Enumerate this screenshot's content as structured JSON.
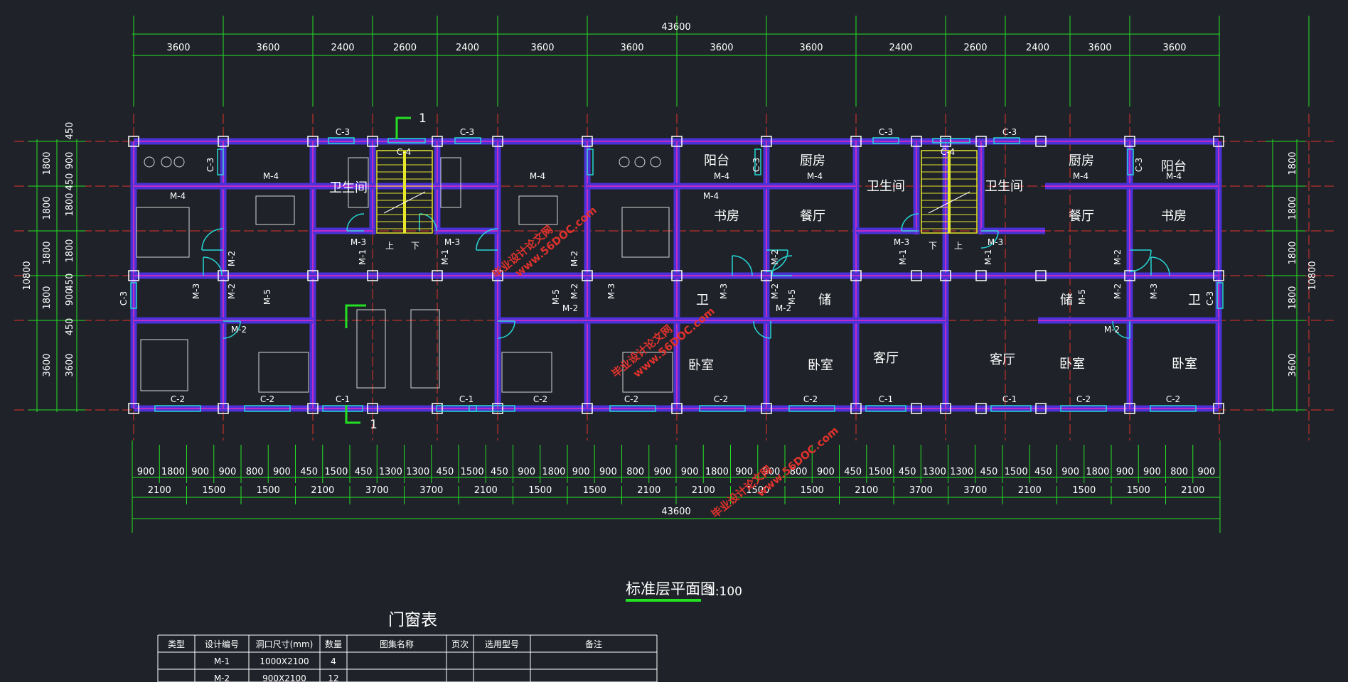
{
  "colors": {
    "background": "#1f2329",
    "dimension_line": "#23e023",
    "axis": "#e0322c",
    "wall": "#4a32d8",
    "wall_finish": "#c22bc2",
    "window": "#27d6d6",
    "stair": "#e6e62a",
    "text": "#ffffff",
    "watermark": "#e0322c"
  },
  "drawing": {
    "overall_top": "43600",
    "overall_bottom": "43600",
    "top_spans": [
      "3600",
      "3600",
      "2400",
      "2600",
      "2400",
      "3600",
      "3600",
      "3600",
      "3600",
      "2400",
      "2600",
      "2400",
      "3600",
      "3600"
    ],
    "bottom_row1": [
      "900",
      "1800",
      "900",
      "900",
      "800",
      "900",
      "450",
      "1500",
      "450",
      "1300",
      "1300",
      "450",
      "1500",
      "450",
      "900",
      "1800",
      "900",
      "900",
      "800",
      "900",
      "900",
      "1800",
      "900",
      "900",
      "800",
      "900",
      "450",
      "1500",
      "450",
      "1300",
      "1300",
      "450",
      "1500",
      "450",
      "900",
      "1800",
      "900",
      "900",
      "800",
      "900"
    ],
    "bottom_row2": [
      "2100",
      "1500",
      "1500",
      "2100",
      "3700",
      "3700",
      "2100",
      "1500",
      "1500",
      "2100",
      "2100",
      "1500",
      "1500",
      "2100",
      "3700",
      "3700",
      "2100",
      "1500",
      "1500",
      "2100"
    ],
    "left_inner": [
      "450",
      "900",
      "450",
      "1800",
      "1800",
      "450",
      "900",
      "450",
      "3600"
    ],
    "left_mid": [
      "1800",
      "1800",
      "1800",
      "1800",
      "3600"
    ],
    "left_total": "10800",
    "right_mid": [
      "1800",
      "1800",
      "1800",
      "1800",
      "3600"
    ],
    "right_total": "10800",
    "rooms": [
      "卫生间",
      "卫生间",
      "卫生间",
      "阳台",
      "厨房",
      "书房",
      "餐厅",
      "餐厅",
      "厨房",
      "阳台",
      "书房",
      "卫",
      "储",
      "卧室",
      "卧室",
      "客厅",
      "客厅",
      "卧室",
      "卧室",
      "卫",
      "储"
    ],
    "tags": [
      "C-3",
      "C-3",
      "C-3",
      "C-3",
      "C-3",
      "C-3",
      "C-3",
      "C-3",
      "C-3",
      "C-4",
      "C-4",
      "M-4",
      "M-4",
      "M-4",
      "M-4",
      "M-4",
      "M-4",
      "M-4",
      "M-4",
      "M-3",
      "M-3",
      "M-3",
      "M-3",
      "M-3",
      "M-3",
      "M-3",
      "M-3",
      "M-1",
      "M-1",
      "M-1",
      "M-1",
      "M-2",
      "M-2",
      "M-2",
      "M-2",
      "M-2",
      "M-2",
      "M-2",
      "M-2",
      "M-2",
      "M-2",
      "M-2",
      "M-2",
      "M-5",
      "M-5",
      "M-5",
      "M-5",
      "C-2",
      "C-2",
      "C-2",
      "C-2",
      "C-2",
      "C-2",
      "C-2",
      "C-2",
      "C-1",
      "C-1",
      "C-1",
      "C-1",
      "上",
      "下",
      "下",
      "上"
    ],
    "section_marks": [
      "1",
      "1"
    ],
    "watermarks": [
      "毕业设计论文网",
      "www.56DOC.com"
    ]
  },
  "title": {
    "text": "标准层平面图",
    "scale": "1:100"
  },
  "table": {
    "caption": "门窗表",
    "headers": [
      "类型",
      "设计编号",
      "洞口尺寸(mm)",
      "数量",
      "图集名称",
      "页次",
      "选用型号",
      "备注"
    ],
    "rows": [
      [
        "",
        "M-1",
        "1000X2100",
        "4",
        "",
        "",
        "",
        ""
      ],
      [
        "",
        "M-2",
        "900X2100",
        "12",
        "",
        "",
        "",
        ""
      ]
    ]
  }
}
